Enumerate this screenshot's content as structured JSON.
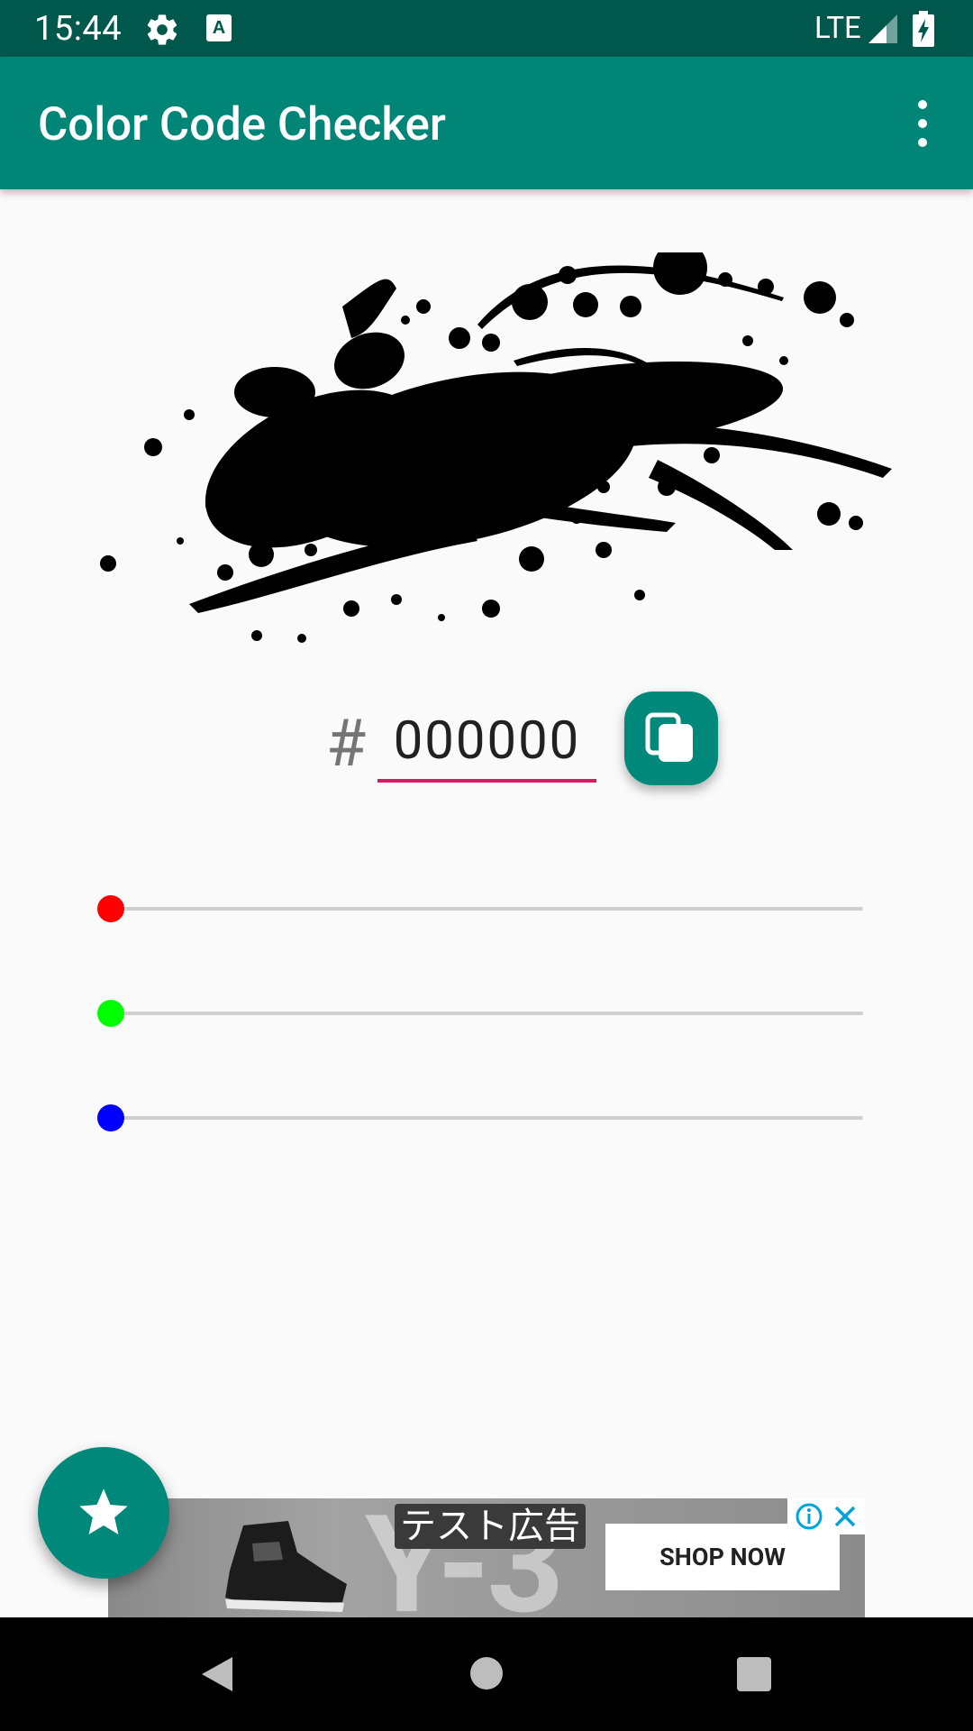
{
  "status_bar": {
    "time": "15:44",
    "network": "LTE",
    "icons": [
      "gear-icon",
      "a-keyboard-icon",
      "signal-icon",
      "battery-charging-icon"
    ]
  },
  "app_bar": {
    "title": "Color Code Checker",
    "overflow_icon": "more-vert-icon"
  },
  "color_preview": {
    "image": "ink-splash",
    "color": "#000000"
  },
  "hex_input": {
    "prefix": "#",
    "value": "000000",
    "underline_color": "#d81b60"
  },
  "copy_button": {
    "icon": "copy-icon",
    "color": "#00897b"
  },
  "sliders": [
    {
      "channel": "red",
      "value": 0,
      "thumb_color": "#ff0000"
    },
    {
      "channel": "green",
      "value": 0,
      "thumb_color": "#00ff00"
    },
    {
      "channel": "blue",
      "value": 0,
      "thumb_color": "#0000ff"
    }
  ],
  "fab": {
    "icon": "star-icon"
  },
  "ad": {
    "label": "テスト広告",
    "cta": "SHOP NOW",
    "watermark": "Y-3",
    "icons": [
      "info-icon",
      "close-icon"
    ]
  },
  "nav_bar": {
    "icons": [
      "back-icon",
      "home-icon",
      "recents-icon"
    ]
  },
  "colors": {
    "primary": "#008577",
    "primary_dark": "#00574b",
    "accent": "#d81b60",
    "background": "#fafafa"
  }
}
